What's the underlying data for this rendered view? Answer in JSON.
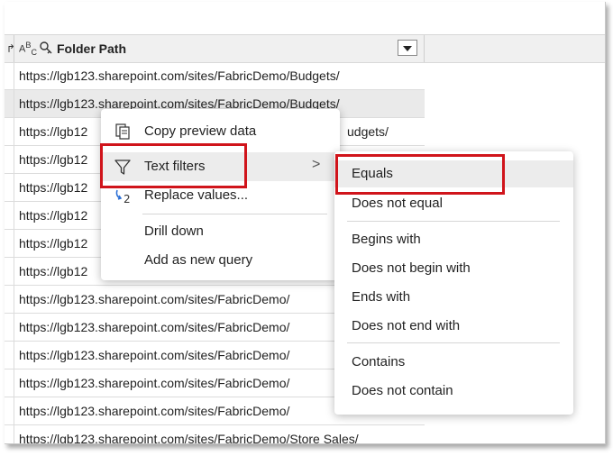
{
  "header": {
    "prev_column_icon": "↱",
    "type_icon_main": "A",
    "type_icon_sup": "B",
    "type_icon_sub": "C",
    "column_title": "Folder Path"
  },
  "rows": [
    "https://lgb123.sharepoint.com/sites/FabricDemo/Budgets/",
    "https://lgb123.sharepoint.com/sites/FabricDemo/Budgets/",
    "https://lgb12",
    "https://lgb12",
    "https://lgb12",
    "https://lgb12",
    "https://lgb12",
    "https://lgb12",
    "https://lgb123.sharepoint.com/sites/FabricDemo/",
    "https://lgb123.sharepoint.com/sites/FabricDemo/",
    "https://lgb123.sharepoint.com/sites/FabricDemo/",
    "https://lgb123.sharepoint.com/sites/FabricDemo/",
    "https://lgb123.sharepoint.com/sites/FabricDemo/",
    "https://lgb123.sharepoint.com/sites/FabricDemo/Store Sales/"
  ],
  "peek_text": "udgets/",
  "peek_text_2": "/",
  "context_menu": {
    "copy_preview": "Copy preview data",
    "text_filters": "Text filters",
    "replace_values": "Replace values...",
    "drill_down": "Drill down",
    "add_query": "Add as new query",
    "submenu_chevron": ">"
  },
  "text_filters_menu": {
    "equals": "Equals",
    "does_not_equal": "Does not equal",
    "begins_with": "Begins with",
    "does_not_begin_with": "Does not begin with",
    "ends_with": "Ends with",
    "does_not_end_with": "Does not end with",
    "contains": "Contains",
    "does_not_contain": "Does not contain"
  },
  "colors": {
    "callout": "#d0141b",
    "highlight": "#ececec",
    "header_bg": "#f0f0f0"
  },
  "icons": {
    "copy": "copy-icon",
    "filter": "filter-icon",
    "replace": "replace-values-icon",
    "key": "key-icon"
  }
}
